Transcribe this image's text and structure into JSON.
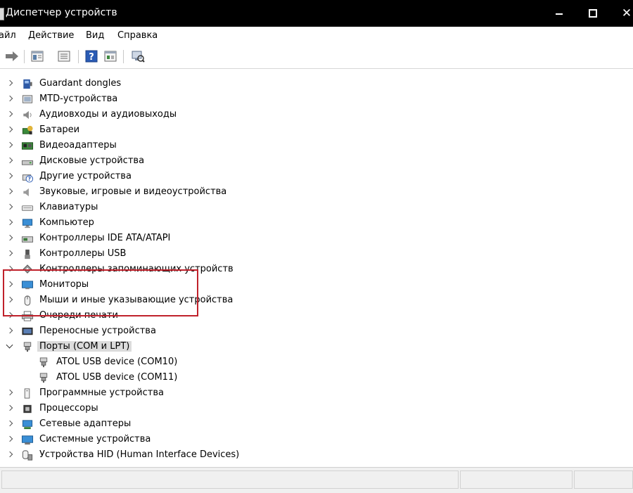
{
  "window": {
    "title": "Диспетчер устройств",
    "controls": [
      "minimize",
      "maximize",
      "close"
    ]
  },
  "menu": {
    "items": [
      "айл",
      "Действие",
      "Вид",
      "Справка"
    ]
  },
  "toolbar": {
    "icons": [
      "forward-arrow-icon",
      "properties-icon",
      "update-driver-icon",
      "help-icon",
      "show-hidden-icon",
      "scan-hardware-icon"
    ]
  },
  "tree": {
    "items": [
      {
        "label": "Guardant dongles",
        "icon": "dongle-icon",
        "expanded": false
      },
      {
        "label": "MTD-устройства",
        "icon": "mtd-device-icon",
        "expanded": false
      },
      {
        "label": "Аудиовходы и аудиовыходы",
        "icon": "speaker-icon",
        "expanded": false
      },
      {
        "label": "Батареи",
        "icon": "battery-icon",
        "expanded": false
      },
      {
        "label": "Видеоадаптеры",
        "icon": "video-adapter-icon",
        "expanded": false
      },
      {
        "label": "Дисковые устройства",
        "icon": "disk-drive-icon",
        "expanded": false
      },
      {
        "label": "Другие устройства",
        "icon": "unknown-device-icon",
        "expanded": false
      },
      {
        "label": "Звуковые, игровые и видеоустройства",
        "icon": "sound-icon",
        "expanded": false
      },
      {
        "label": "Клавиатуры",
        "icon": "keyboard-icon",
        "expanded": false
      },
      {
        "label": "Компьютер",
        "icon": "computer-icon",
        "expanded": false
      },
      {
        "label": "Контроллеры IDE ATA/ATAPI",
        "icon": "ide-controller-icon",
        "expanded": false
      },
      {
        "label": "Контроллеры USB",
        "icon": "usb-icon",
        "expanded": false
      },
      {
        "label": "Контроллеры запоминающих устройств",
        "icon": "storage-controller-icon",
        "expanded": false
      },
      {
        "label": "Мониторы",
        "icon": "monitor-icon",
        "expanded": false
      },
      {
        "label": "Мыши и иные указывающие устройства",
        "icon": "mouse-icon",
        "expanded": false
      },
      {
        "label": "Очереди печати",
        "icon": "printer-icon",
        "expanded": false
      },
      {
        "label": "Переносные устройства",
        "icon": "portable-device-icon",
        "expanded": false
      },
      {
        "label": "Порты (COM и LPT)",
        "icon": "port-icon",
        "expanded": true,
        "selected": true
      },
      {
        "label": "ATOL USB device (COM10)",
        "icon": "port-icon",
        "child": true
      },
      {
        "label": "ATOL USB device (COM11)",
        "icon": "port-icon",
        "child": true
      },
      {
        "label": "Программные устройства",
        "icon": "software-device-icon",
        "expanded": false
      },
      {
        "label": "Процессоры",
        "icon": "processor-icon",
        "expanded": false
      },
      {
        "label": "Сетевые адаптеры",
        "icon": "network-adapter-icon",
        "expanded": false
      },
      {
        "label": "Системные устройства",
        "icon": "system-device-icon",
        "expanded": false
      },
      {
        "label": "Устройства HID (Human Interface Devices)",
        "icon": "hid-icon",
        "expanded": false
      }
    ]
  },
  "colors": {
    "titlebar": "#000000",
    "highlight_border": "#c0212b",
    "selection": "#dcdcdc"
  }
}
